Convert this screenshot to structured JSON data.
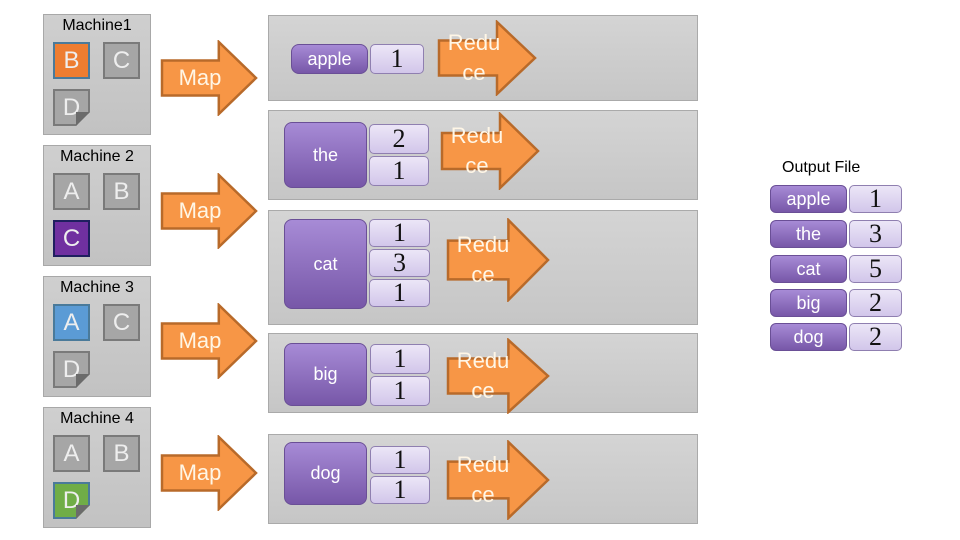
{
  "machines": [
    {
      "title": "Machine1",
      "blocks": [
        {
          "label": "B",
          "color": "#ed7d31",
          "doc": false
        },
        {
          "label": "C",
          "color": "#a6a6a6",
          "doc": false
        },
        {
          "label": "D",
          "color": "#a6a6a6",
          "doc": true
        }
      ]
    },
    {
      "title": "Machine 2",
      "blocks": [
        {
          "label": "A",
          "color": "#a6a6a6",
          "doc": false
        },
        {
          "label": "B",
          "color": "#a6a6a6",
          "doc": false
        },
        {
          "label": "C",
          "color": "#7030a0",
          "doc": false
        }
      ]
    },
    {
      "title": "Machine 3",
      "blocks": [
        {
          "label": "A",
          "color": "#5b9bd5",
          "doc": false
        },
        {
          "label": "C",
          "color": "#a6a6a6",
          "doc": false
        },
        {
          "label": "D",
          "color": "#a6a6a6",
          "doc": true
        }
      ]
    },
    {
      "title": "Machine 4",
      "blocks": [
        {
          "label": "A",
          "color": "#a6a6a6",
          "doc": false
        },
        {
          "label": "B",
          "color": "#a6a6a6",
          "doc": false
        },
        {
          "label": "D",
          "color": "#70ad47",
          "doc": true
        }
      ]
    }
  ],
  "map_label": "Map",
  "reduce_label": "Reduce",
  "groups": [
    {
      "key": "apple",
      "counts": [
        "1"
      ]
    },
    {
      "key": "the",
      "counts": [
        "2",
        "1"
      ]
    },
    {
      "key": "cat",
      "counts": [
        "1",
        "3",
        "1"
      ]
    },
    {
      "key": "big",
      "counts": [
        "1",
        "1"
      ]
    },
    {
      "key": "dog",
      "counts": [
        "1",
        "1"
      ]
    }
  ],
  "output": {
    "title": "Output File",
    "rows": [
      {
        "key": "apple",
        "count": "1"
      },
      {
        "key": "the",
        "count": "3"
      },
      {
        "key": "cat",
        "count": "5"
      },
      {
        "key": "big",
        "count": "2"
      },
      {
        "key": "dog",
        "count": "2"
      }
    ]
  },
  "colors": {
    "arrow_fill": "#f79646",
    "arrow_stroke": "#b86a2a",
    "key_purple": "#8064a2"
  }
}
